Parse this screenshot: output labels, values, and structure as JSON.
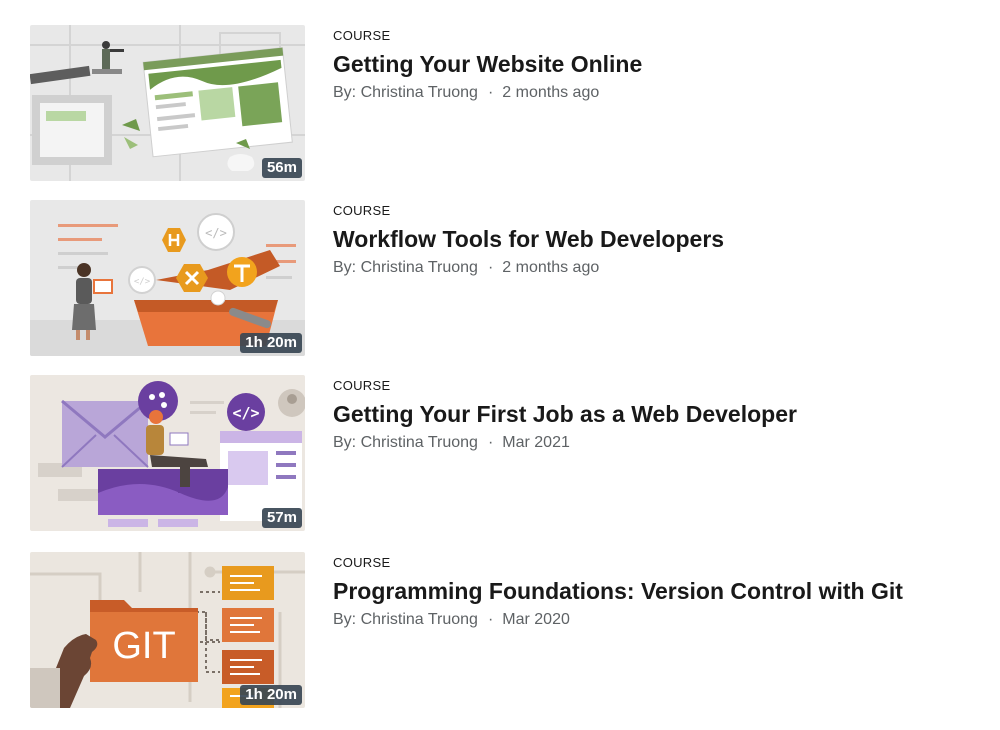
{
  "courses": [
    {
      "kind": "COURSE",
      "title": "Getting Your Website Online",
      "author": "By: Christina Truong",
      "separator": "·",
      "date": "2 months ago",
      "duration": "56m",
      "thumbnail_icon": "website-online-illustration"
    },
    {
      "kind": "COURSE",
      "title": "Workflow Tools for Web Developers",
      "author": "By: Christina Truong",
      "separator": "·",
      "date": "2 months ago",
      "duration": "1h 20m",
      "thumbnail_icon": "toolbox-illustration"
    },
    {
      "kind": "COURSE",
      "title": "Getting Your First Job as a Web Developer",
      "author": "By: Christina Truong",
      "separator": "·",
      "date": "Mar 2021",
      "duration": "57m",
      "thumbnail_icon": "web-developer-job-illustration"
    },
    {
      "kind": "COURSE",
      "title": "Programming Foundations: Version Control with Git",
      "author": "By: Christina Truong",
      "separator": "·",
      "date": "Mar 2020",
      "duration": "1h 20m",
      "thumbnail_icon": "git-folder-illustration",
      "thumbnail_text": "GIT"
    }
  ]
}
